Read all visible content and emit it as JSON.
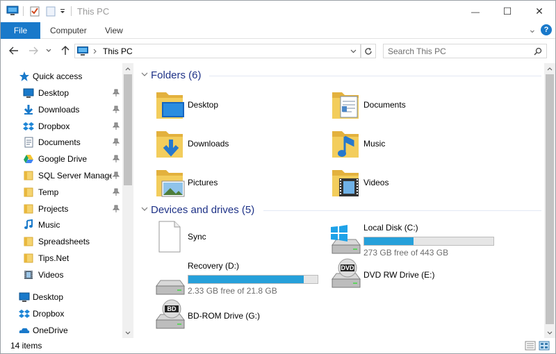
{
  "window": {
    "title": "This PC",
    "minimize_glyph": "—",
    "maximize_glyph": "☐",
    "close_glyph": "✕"
  },
  "ribbon": {
    "tabs": [
      "File",
      "Computer",
      "View"
    ],
    "expand_glyph": "⌄",
    "help_glyph": "?"
  },
  "address": {
    "path": "This PC",
    "search_placeholder": "Search This PC"
  },
  "nav": {
    "quick_access": "Quick access",
    "items": [
      {
        "label": "Desktop",
        "icon": "desktop-icon",
        "pinned": true
      },
      {
        "label": "Downloads",
        "icon": "downloads-icon",
        "pinned": true
      },
      {
        "label": "Dropbox",
        "icon": "dropbox-icon",
        "pinned": true
      },
      {
        "label": "Documents",
        "icon": "documents-icon",
        "pinned": true
      },
      {
        "label": "Google Drive",
        "icon": "google-drive-icon",
        "pinned": true
      },
      {
        "label": "SQL Server Managem",
        "icon": "folder-icon",
        "pinned": true
      },
      {
        "label": "Temp",
        "icon": "folder-icon",
        "pinned": true
      },
      {
        "label": "Projects",
        "icon": "folder-icon",
        "pinned": true
      },
      {
        "label": "Music",
        "icon": "music-icon",
        "pinned": false
      },
      {
        "label": "Spreadsheets",
        "icon": "folder-icon",
        "pinned": false
      },
      {
        "label": "Tips.Net",
        "icon": "folder-icon",
        "pinned": false
      },
      {
        "label": "Videos",
        "icon": "videos-icon",
        "pinned": false
      }
    ],
    "roots": [
      {
        "label": "Desktop",
        "icon": "desktop-icon"
      },
      {
        "label": "Dropbox",
        "icon": "dropbox-icon"
      },
      {
        "label": "OneDrive",
        "icon": "onedrive-icon"
      }
    ]
  },
  "content": {
    "folders_title": "Folders (6)",
    "folders": [
      {
        "name": "Desktop",
        "icon": "desktop-folder-icon"
      },
      {
        "name": "Documents",
        "icon": "documents-folder-icon"
      },
      {
        "name": "Downloads",
        "icon": "downloads-folder-icon"
      },
      {
        "name": "Music",
        "icon": "music-folder-icon"
      },
      {
        "name": "Pictures",
        "icon": "pictures-folder-icon"
      },
      {
        "name": "Videos",
        "icon": "videos-folder-icon"
      }
    ],
    "drives_title": "Devices and drives (5)",
    "drives": [
      {
        "name": "Sync",
        "icon": "blank-file-icon"
      },
      {
        "name": "Local Disk (C:)",
        "icon": "windows-drive-icon",
        "free": "273 GB free of 443 GB",
        "used_fraction": 0.38
      },
      {
        "name": "Recovery (D:)",
        "icon": "hard-drive-icon",
        "free": "2.33 GB free of 21.8 GB",
        "used_fraction": 0.893
      },
      {
        "name": "DVD RW Drive (E:)",
        "icon": "dvd-drive-icon",
        "badge": "DVD"
      },
      {
        "name": "BD-ROM Drive (G:)",
        "icon": "bd-drive-icon",
        "badge": "BD"
      }
    ]
  },
  "status": {
    "item_count": "14 items"
  },
  "colors": {
    "accent": "#1979ca",
    "group_title": "#1e3287",
    "drive_bar": "#26a0da",
    "folder": "#f0c54a"
  }
}
